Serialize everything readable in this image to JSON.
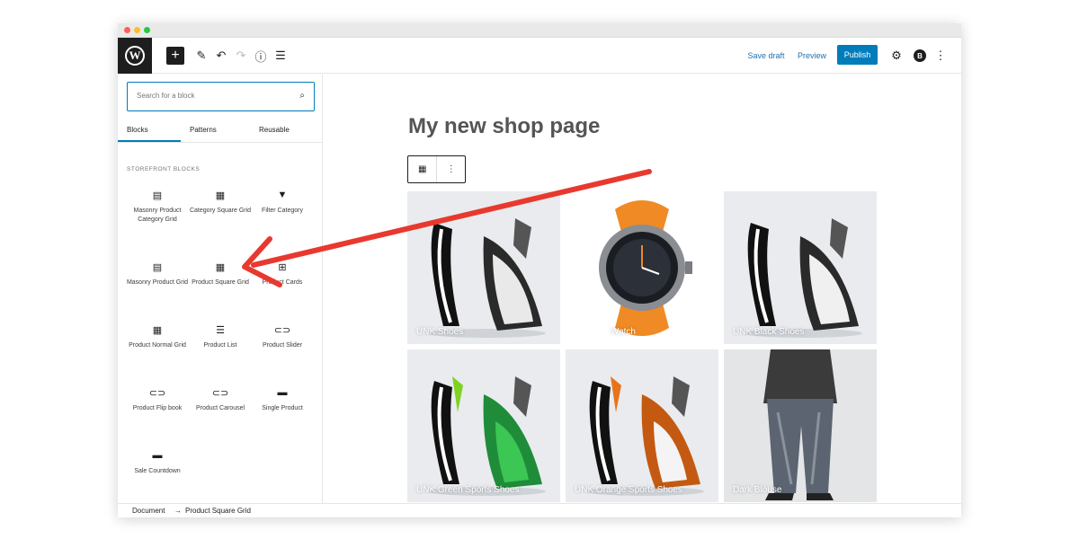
{
  "topbar": {
    "save_draft": "Save draft",
    "preview": "Preview",
    "publish": "Publish",
    "avatar_letter": "B"
  },
  "sidebar": {
    "search_placeholder": "Search for a block",
    "tabs": [
      "Blocks",
      "Patterns",
      "Reusable"
    ],
    "section_title": "STOREFRONT BLOCKS",
    "blocks": [
      {
        "label": "Masonry Product Category Grid",
        "icon": "masonry-icon"
      },
      {
        "label": "Category Square Grid",
        "icon": "grid-icon"
      },
      {
        "label": "Filter Category",
        "icon": "filter-icon"
      },
      {
        "label": "Masonry Product Grid",
        "icon": "masonry-icon"
      },
      {
        "label": "Product Square Grid",
        "icon": "grid-icon"
      },
      {
        "label": "Product Cards",
        "icon": "table-icon"
      },
      {
        "label": "Product Normal Grid",
        "icon": "grid-icon"
      },
      {
        "label": "Product List",
        "icon": "list-icon"
      },
      {
        "label": "Product Slider",
        "icon": "slider-icon"
      },
      {
        "label": "Product Flip book",
        "icon": "slider-icon"
      },
      {
        "label": "Product Carousel",
        "icon": "slider-icon"
      },
      {
        "label": "Single Product",
        "icon": "card-icon"
      },
      {
        "label": "Sale Countdown",
        "icon": "card-icon"
      }
    ]
  },
  "canvas": {
    "page_title": "My new shop page",
    "products": [
      {
        "name": "UNK Shoes"
      },
      {
        "name": "Watch"
      },
      {
        "name": "UNK Black Shoes"
      },
      {
        "name": "UNK Green Sports Shoes"
      },
      {
        "name": "UNK Orange Sports Shoes"
      },
      {
        "name": "Dark Blouse"
      }
    ]
  },
  "footer": {
    "document": "Document",
    "separator": "→",
    "current": "Product Square Grid"
  },
  "colors": {
    "accent": "#007cba",
    "arrow": "#e8392f",
    "watch_strap": "#f08a24"
  }
}
